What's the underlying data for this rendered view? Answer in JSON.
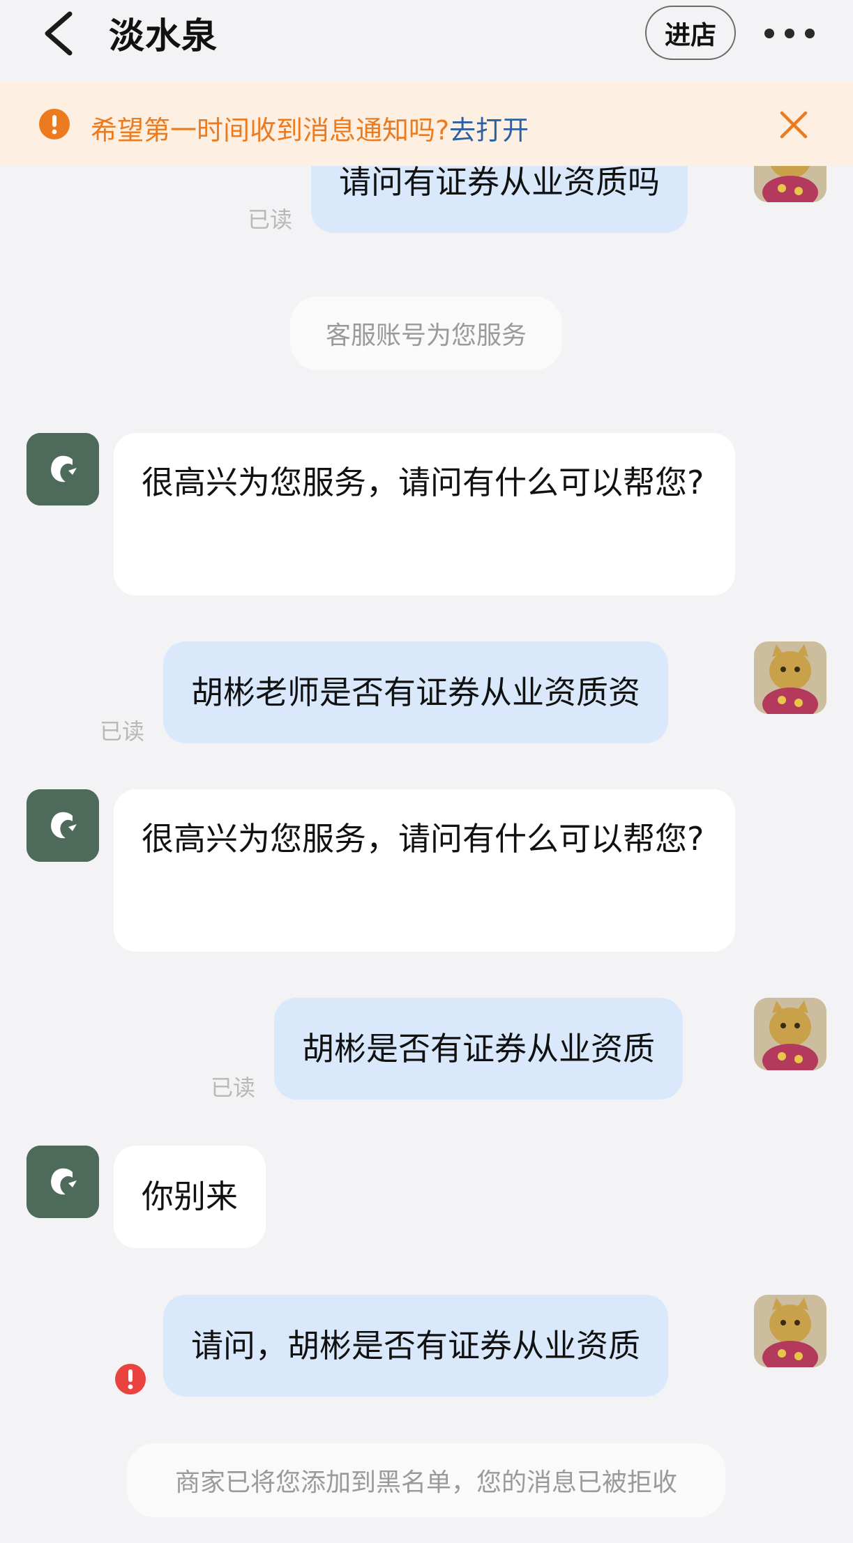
{
  "header": {
    "title": "淡水泉",
    "shop_button": "进店"
  },
  "notice": {
    "text": "希望第一时间收到消息通知吗?",
    "link": "去打开"
  },
  "messages": [
    {
      "from": "me",
      "text": "请问有证券从业资质吗",
      "read": "已读"
    },
    {
      "system": "客服账号为您服务"
    },
    {
      "from": "them",
      "text": "很高兴为您服务，请问有什么可以帮您?"
    },
    {
      "from": "me",
      "text": "胡彬老师是否有证券从业资质资",
      "read": "已读"
    },
    {
      "from": "them",
      "text": "很高兴为您服务，请问有什么可以帮您?"
    },
    {
      "from": "me",
      "text": "胡彬是否有证券从业资质",
      "read": "已读"
    },
    {
      "from": "them",
      "text": "你别来"
    },
    {
      "from": "me",
      "text": "请问，胡彬是否有证券从业资质",
      "status": "failed"
    },
    {
      "system": "商家已将您添加到黑名单，您的消息已被拒收"
    }
  ],
  "colors": {
    "background": "#f3f3f6",
    "my_bubble": "#d9e9fb",
    "their_bubble": "#ffffff",
    "notice_bg": "#fdf0e2",
    "notice_text": "#ec7a1f",
    "notice_link": "#2d5fa3",
    "shop_avatar": "#4d6a5b",
    "error": "#e9423f"
  }
}
